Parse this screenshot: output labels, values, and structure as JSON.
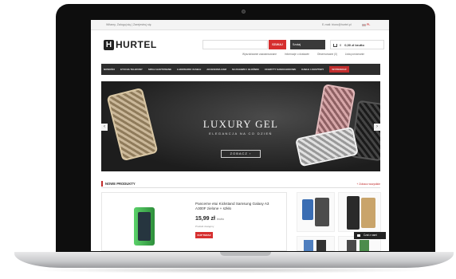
{
  "topbar": {
    "links": "Witamy, Zaloguj się | Zarejestruj się",
    "email": "E-mail: biuro@hurtel.pl",
    "lang": "PL"
  },
  "header": {
    "logo_mark": "H",
    "logo_text": "HURTEL",
    "search_placeholder": "",
    "search_button": "SZUKAJ",
    "category": "Szukaj",
    "cart_count": "0",
    "cart_total": "0,00 zł brutto"
  },
  "sublinks": [
    "Wyszukiwanie zaawansowane",
    "Informacje o dostawie",
    "Obserwowane (0)",
    "Lista porównanie"
  ],
  "nav": {
    "items": [
      "NOWOŚCI",
      "ETUI NA TELEFONY",
      "SZKŁA HARTOWANE",
      "ŁADOWARKI I KABLE",
      "AKCESORIA GSM",
      "SŁUCHAWKI I GŁOŚNIKI",
      "UCHWYTY SAMOCHODOWE",
      "KABLE I ADAPTERY",
      "WYPRZEDAŻ"
    ]
  },
  "hero": {
    "title": "LUXURY GEL",
    "subtitle": "ELEGANCJA NA CO DZIEŃ",
    "button": "ZOBACZ ›",
    "arrow_left": "‹",
    "arrow_right": "›"
  },
  "section": {
    "title": "NOWE PRODUKTY",
    "more": "+ Zobacz wszystkie"
  },
  "product": {
    "name": "Pancerne etui Kickstand Samsung Galaxy A3 A300F zielone + szkło",
    "price": "15,99 zł",
    "price_suffix": "brutto",
    "availability": "Produkt dostępny",
    "buy": "KUP TERAZ"
  },
  "chat": {
    "label": "Czat z nami"
  }
}
